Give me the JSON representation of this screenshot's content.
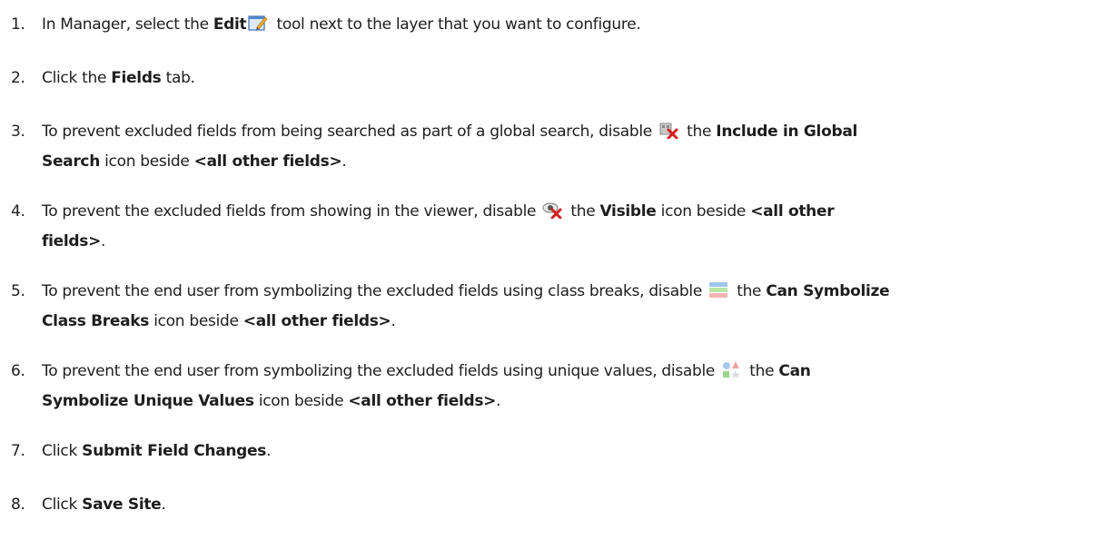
{
  "steps": [
    {
      "number": "1.",
      "pre": "In Manager, select the ",
      "bold": "Edit",
      "icon": "edit-pencil-icon",
      "post": " tool next to the layer that you want to configure."
    },
    {
      "number": "2.",
      "pre": "Click the ",
      "bold": "Fields",
      "post": " tab."
    },
    {
      "number": "3.",
      "pre": "To prevent excluded fields from being searched as part of a global search, disable ",
      "icon": "global-search-disabled-icon",
      "mid": " the ",
      "bold1": "Include in Global",
      "bold2": "Search",
      "post": " icon beside ",
      "bold3": "<all other fields>",
      "end": "."
    },
    {
      "number": "4.",
      "pre": "To prevent the excluded fields from showing in the viewer, disable ",
      "icon": "visible-disabled-icon",
      "mid": " the ",
      "bold1": "Visible",
      "post": " icon beside ",
      "bold2": "<all other",
      "bold3": "fields>",
      "end": "."
    },
    {
      "number": "5.",
      "pre": "To prevent the end user from symbolizing the excluded fields using class breaks, disable ",
      "icon": "class-breaks-icon",
      "mid": " the ",
      "bold1": "Can Symbolize",
      "bold2": "Class Breaks",
      "post": " icon beside ",
      "bold3": "<all other fields>",
      "end": "."
    },
    {
      "number": "6.",
      "pre": "To prevent the end user from symbolizing the excluded fields using unique values, disable ",
      "icon": "unique-values-icon",
      "mid": " the ",
      "bold1": "Can",
      "bold2": "Symbolize Unique Values",
      "post": " icon beside ",
      "bold3": "<all other fields>",
      "end": "."
    },
    {
      "number": "7.",
      "pre": "Click ",
      "bold": "Submit Field Changes",
      "end": "."
    },
    {
      "number": "8.",
      "pre": "Click ",
      "bold": "Save Site",
      "end": "."
    }
  ]
}
